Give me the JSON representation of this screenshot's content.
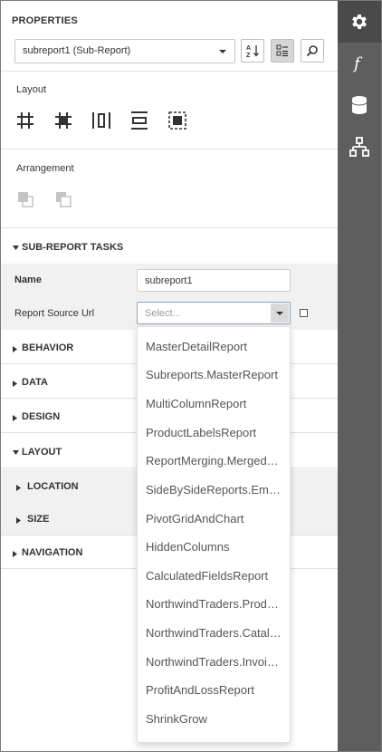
{
  "panel": {
    "title": "PROPERTIES",
    "component_select": "subreport1 (Sub-Report)"
  },
  "layout_section": {
    "label": "Layout"
  },
  "arrangement_section": {
    "label": "Arrangement"
  },
  "groups": {
    "sub_report_tasks": "SUB-REPORT TASKS",
    "behavior": "BEHAVIOR",
    "data": "DATA",
    "design": "DESIGN",
    "layout": "LAYOUT",
    "location": "LOCATION",
    "size": "SIZE",
    "navigation": "NAVIGATION"
  },
  "tasks": {
    "name_label": "Name",
    "name_value": "subreport1",
    "report_source_label": "Report Source Url",
    "report_source_placeholder": "Select..."
  },
  "dropdown": {
    "items": [
      "MasterDetailReport",
      "Subreports.MasterReport",
      "MultiColumnReport",
      "ProductLabelsReport",
      "ReportMerging.Merged…",
      "SideBySideReports.Emp…",
      "PivotGridAndChart",
      "HiddenColumns",
      "CalculatedFieldsReport",
      "NorthwindTraders.Prod…",
      "NorthwindTraders.Catal…",
      "NorthwindTraders.Invoi…",
      "ProfitAndLossReport",
      "ShrinkGrow"
    ]
  },
  "rail": {
    "icons": [
      "gear-icon",
      "function-icon",
      "database-icon",
      "hierarchy-icon"
    ]
  },
  "colors": {
    "rail": "#5e5e5e",
    "rail_active": "#4a4a4a",
    "group_bg": "#f1f1f1",
    "select_border": "#7fa6c9"
  }
}
